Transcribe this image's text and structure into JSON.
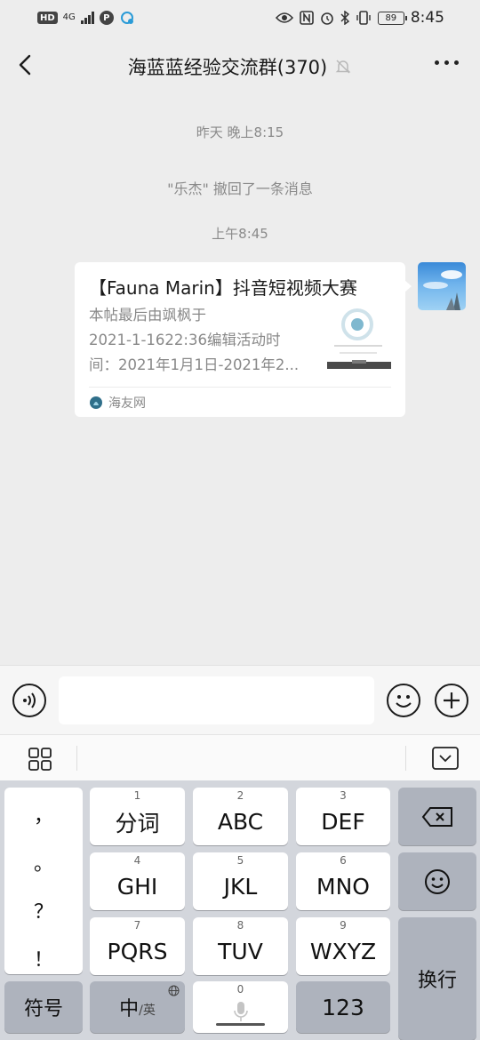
{
  "status_bar": {
    "hd": "HD",
    "network": "4G",
    "p_badge": "P",
    "battery": "89",
    "time": "8:45"
  },
  "header": {
    "title": "海蓝蓝经验交流群(370)",
    "icons": [
      "back-icon",
      "mute-bell-icon",
      "more-icon"
    ]
  },
  "chat": {
    "timestamp_1": "昨天 晚上8:15",
    "recall_notice": "\"乐杰\" 撤回了一条消息",
    "timestamp_2": "上午8:45",
    "card": {
      "title": "【Fauna Marin】抖音短视频大赛",
      "desc_lines": [
        "本帖最后由飒枫于",
        "2021-1-1622:36编辑活动时",
        "间：2021年1月1日-2021年2..."
      ],
      "source": "海友网"
    }
  },
  "input_bar": {
    "text_value": "",
    "icons": [
      "voice-icon",
      "emoji-icon",
      "plus-icon"
    ]
  },
  "keyboard": {
    "punct": [
      "，",
      "。",
      "？",
      "！"
    ],
    "keys": [
      {
        "num": "1",
        "label": "分词"
      },
      {
        "num": "2",
        "label": "ABC"
      },
      {
        "num": "3",
        "label": "DEF"
      },
      {
        "num": "4",
        "label": "GHI"
      },
      {
        "num": "5",
        "label": "JKL"
      },
      {
        "num": "6",
        "label": "MNO"
      },
      {
        "num": "7",
        "label": "PQRS"
      },
      {
        "num": "8",
        "label": "TUV"
      },
      {
        "num": "9",
        "label": "WXYZ"
      }
    ],
    "symbols_label": "符号",
    "lang_main": "中",
    "lang_sub": "/英",
    "space_num": "0",
    "num_label": "123",
    "enter_label": "换行",
    "icons": [
      "backspace-icon",
      "emoji-key-icon",
      "globe-icon",
      "mic-icon",
      "grid-menu-icon",
      "hide-keyboard-icon"
    ]
  },
  "colors": {
    "background": "#ededed",
    "keyboard_bg": "#d3d6dc",
    "key_white": "#ffffff",
    "key_gray": "#aeb3bd",
    "system_text": "#8a8a8a"
  }
}
